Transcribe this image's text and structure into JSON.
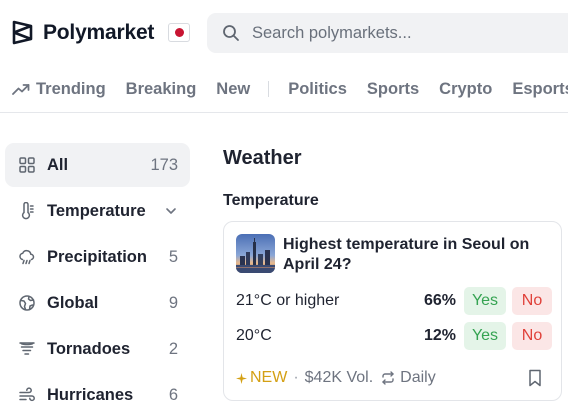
{
  "header": {
    "logo_text": "Polymarket",
    "search_placeholder": "Search polymarkets..."
  },
  "nav": {
    "items": [
      {
        "label": "Trending",
        "icon": "trending-up-icon"
      },
      {
        "label": "Breaking"
      },
      {
        "label": "New"
      },
      {
        "label": "Politics"
      },
      {
        "label": "Sports"
      },
      {
        "label": "Crypto"
      },
      {
        "label": "Esports"
      }
    ]
  },
  "sidebar": {
    "items": [
      {
        "label": "All",
        "count": "173",
        "icon": "grid-icon",
        "active": true
      },
      {
        "label": "Temperature",
        "count": "",
        "icon": "thermometer-icon",
        "expandable": true
      },
      {
        "label": "Precipitation",
        "count": "5",
        "icon": "cloud-rain-icon"
      },
      {
        "label": "Global",
        "count": "9",
        "icon": "globe-icon"
      },
      {
        "label": "Tornadoes",
        "count": "2",
        "icon": "tornado-icon"
      },
      {
        "label": "Hurricanes",
        "count": "6",
        "icon": "wind-icon"
      }
    ]
  },
  "main": {
    "title": "Weather",
    "section": "Temperature",
    "card": {
      "question": "Highest temperature in Seoul on April 24?",
      "outcomes": [
        {
          "label": "21°C or higher",
          "pct": "66%",
          "yes": "Yes",
          "no": "No"
        },
        {
          "label": "20°C",
          "pct": "12%",
          "yes": "Yes",
          "no": "No"
        }
      ],
      "new_label": "NEW",
      "separator": "·",
      "volume": "$42K Vol.",
      "recurrence": "Daily"
    }
  },
  "colors": {
    "yes_bg": "#e4f4e8",
    "yes_text": "#35a352",
    "no_bg": "#fbe6e6",
    "no_text": "#e0413a",
    "new_text": "#d4a014",
    "flag_red": "#c81432"
  }
}
